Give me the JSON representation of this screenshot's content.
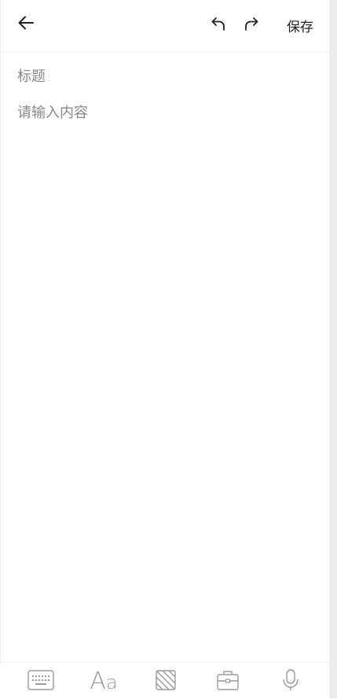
{
  "header": {
    "save_label": "保存",
    "icons": [
      "arrow-left-icon",
      "undo-icon",
      "redo-icon"
    ]
  },
  "editor": {
    "title_placeholder": "标题",
    "content_placeholder": "请输入内容"
  },
  "toolbar": {
    "items": [
      {
        "name": "keyboard",
        "icon": "keyboard-icon"
      },
      {
        "name": "text-format",
        "icon": "text-format-icon",
        "label": "Aa"
      },
      {
        "name": "background",
        "icon": "striped-pattern-icon"
      },
      {
        "name": "toolbox",
        "icon": "briefcase-icon"
      },
      {
        "name": "voice",
        "icon": "microphone-icon"
      }
    ]
  },
  "colors": {
    "background": "#ffffff",
    "text_primary": "#222222",
    "placeholder": "#8a8a8a",
    "toolbar_icon": "#9a9a9a",
    "divider": "#f0f0f0"
  }
}
